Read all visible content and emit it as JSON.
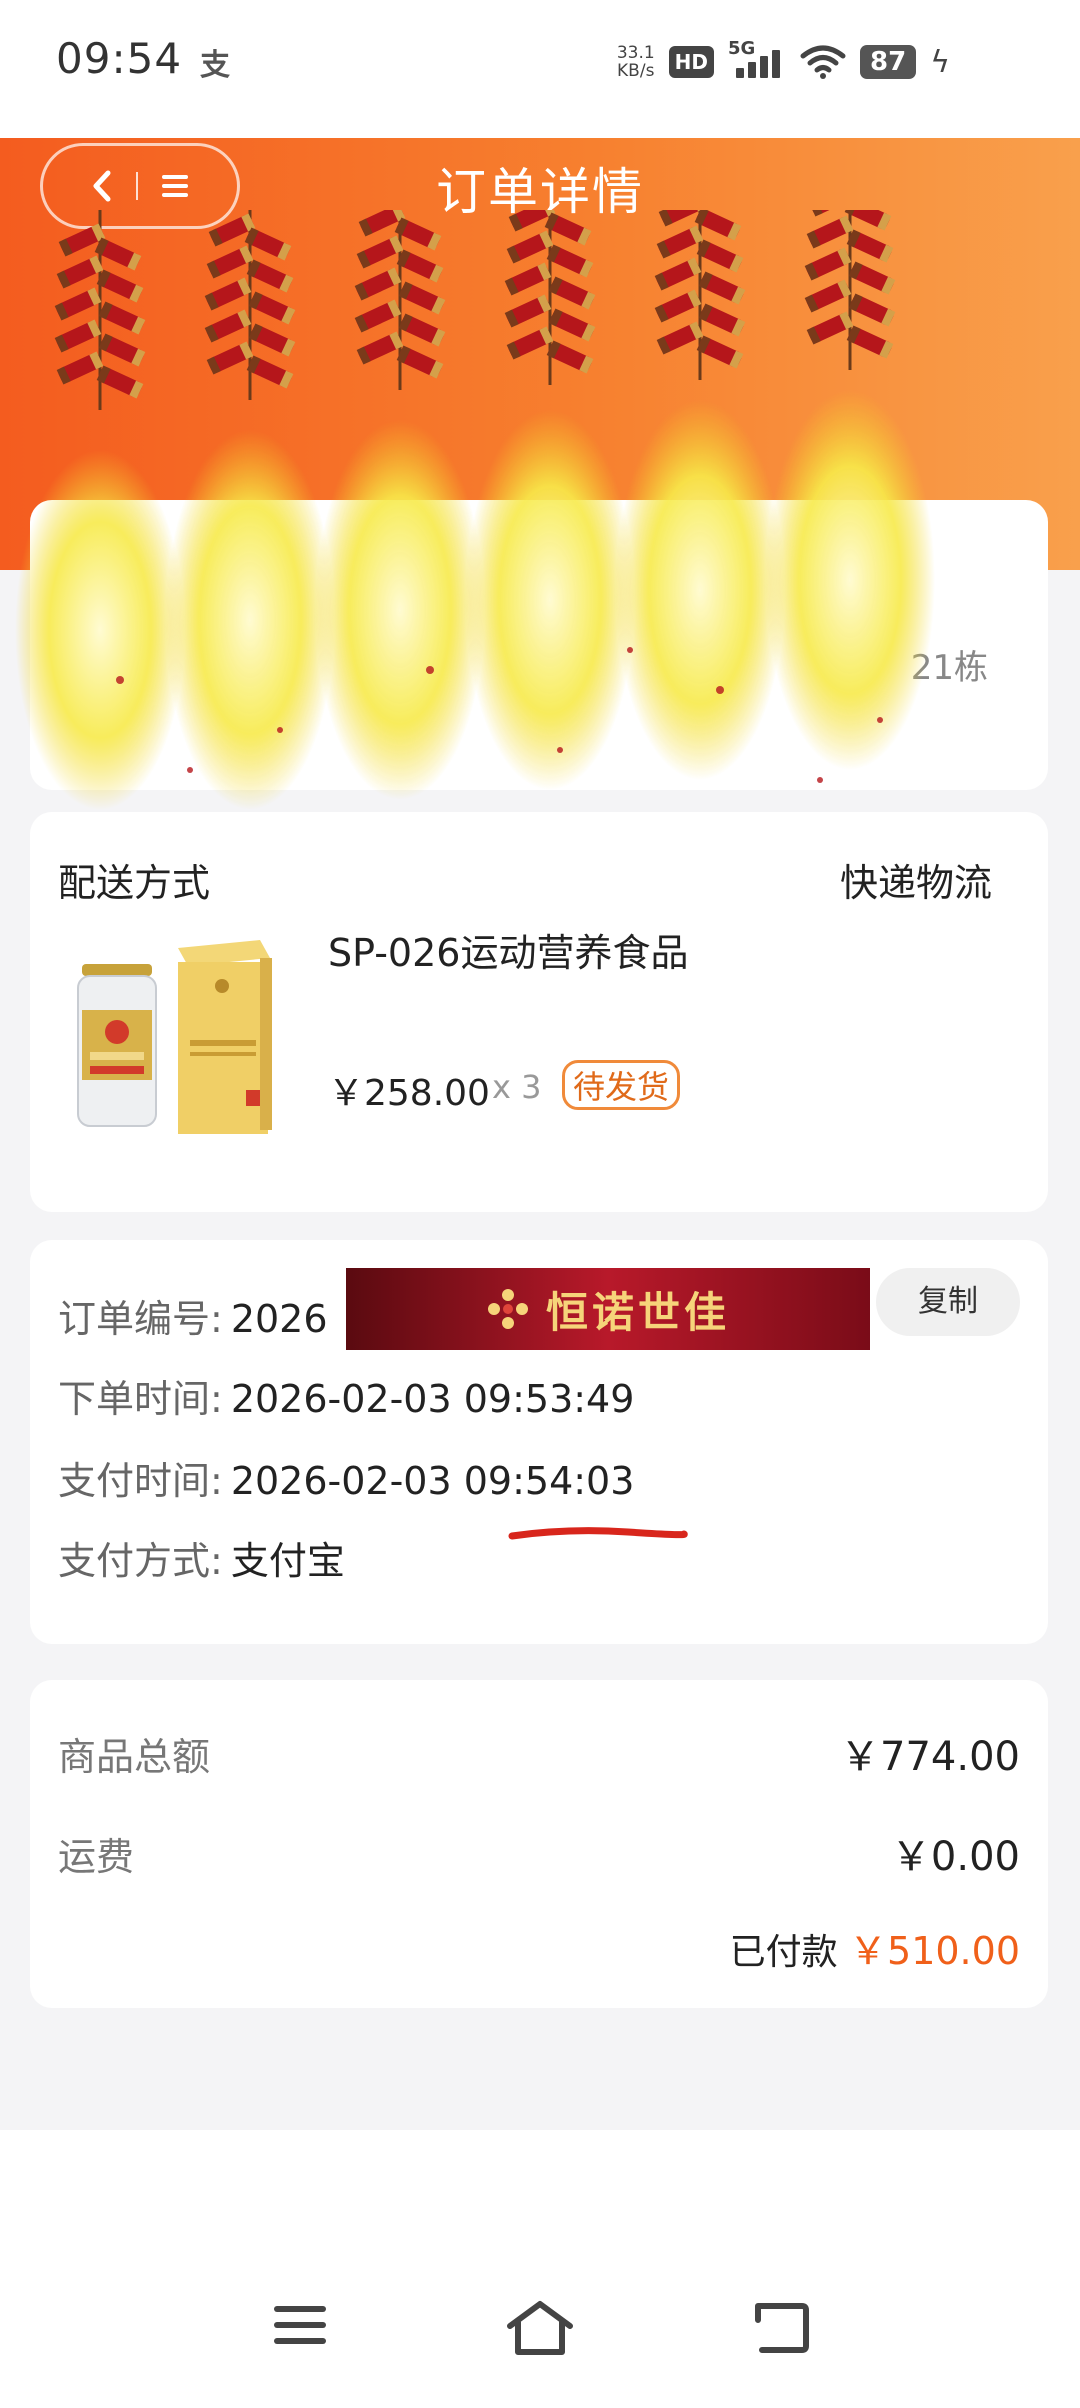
{
  "status_bar": {
    "time": "09:54",
    "alipay_glyph": "支",
    "speed_value": "33.1",
    "speed_unit": "KB/s",
    "hd": "HD",
    "network": "5G",
    "battery": "87",
    "icons": [
      "alipay-icon",
      "hd-icon",
      "signal-icon",
      "wifi-icon",
      "battery-icon",
      "charging-icon"
    ]
  },
  "header": {
    "title": "订单详情",
    "capsule": {
      "back_icon": "chevron-left-icon",
      "menu_icon": "menu-icon"
    },
    "accent_color": "#f46a24"
  },
  "address": {
    "partial_text": "21栋"
  },
  "delivery": {
    "label": "配送方式",
    "value": "快递物流"
  },
  "product": {
    "name": "SP-026运动营养食品",
    "price": "￥258.00",
    "quantity": "x 3",
    "status": "待发货"
  },
  "order_info": {
    "order_no_label": "订单编号:",
    "order_no_value": "2026",
    "overlay_banner_text": "恒诺世佳",
    "copy_button": "复制",
    "order_time_label": "下单时间:",
    "order_time_value": "2026-02-03 09:53:49",
    "pay_time_label": "支付时间:",
    "pay_time_value": "2026-02-03 09:54:03",
    "pay_method_label": "支付方式:",
    "pay_method_value": "支付宝"
  },
  "price_summary": {
    "goods_total_label": "商品总额",
    "goods_total_value": "￥774.00",
    "shipping_label": "运费",
    "shipping_value": "￥0.00",
    "paid_label": "已付款",
    "paid_value": "￥510.00",
    "paid_color": "#f0601a"
  },
  "navigation_bar": {
    "icons": [
      "menu-icon",
      "home-icon",
      "back-icon"
    ]
  }
}
